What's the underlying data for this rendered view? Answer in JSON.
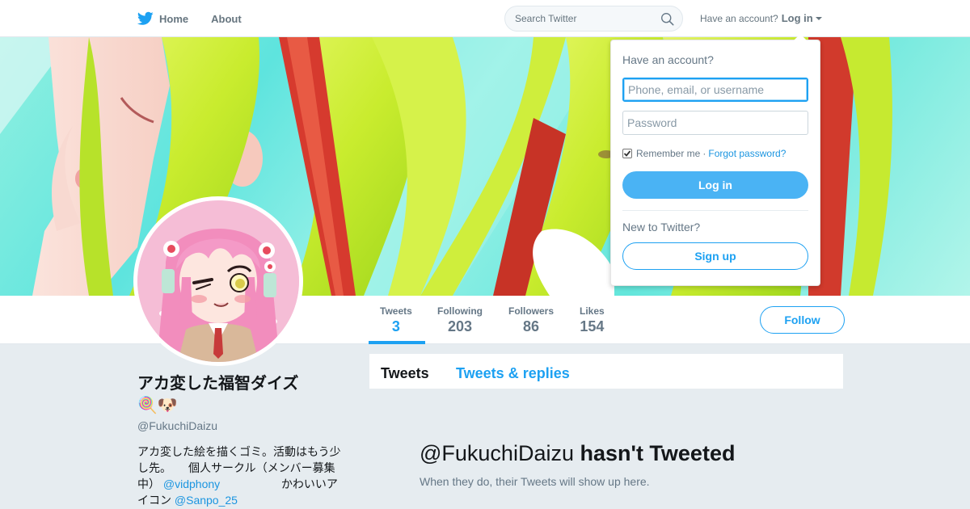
{
  "nav": {
    "home_label": "Home",
    "about_label": "About",
    "search_placeholder": "Search Twitter",
    "account_prompt": "Have an account?",
    "login_label": "Log in"
  },
  "login_dropdown": {
    "heading": "Have an account?",
    "username_placeholder": "Phone, email, or username",
    "password_placeholder": "Password",
    "remember_label": "Remember me",
    "separator": "·",
    "forgot_label": "Forgot password?",
    "remember_checked": true,
    "login_button": "Log in",
    "new_prompt": "New to Twitter?",
    "signup_button": "Sign up"
  },
  "profile": {
    "name": "アカ変した福智ダイズ🍭🐶",
    "handle": "@FukuchiDaizu",
    "bio_text_1": "アカ変した絵を描くゴミ。活動はもう少し先。　　個人サークル（メンバー募集中）",
    "bio_link_1": "@vidphony",
    "bio_text_2": "かわいいアイコン",
    "bio_link_2": "@Sanpo_25"
  },
  "stats": [
    {
      "label": "Tweets",
      "value": "3"
    },
    {
      "label": "Following",
      "value": "203"
    },
    {
      "label": "Followers",
      "value": "86"
    },
    {
      "label": "Likes",
      "value": "154"
    }
  ],
  "follow_button": "Follow",
  "timeline": {
    "tabs": [
      "Tweets",
      "Tweets & replies"
    ],
    "empty_handle": "@FukuchiDaizu",
    "empty_title_rest": "hasn't Tweeted",
    "empty_sub": "When they do, their Tweets will show up here."
  },
  "colors": {
    "accent": "#1da1f2",
    "link": "#1b95e0",
    "background": "#e6ecf0"
  }
}
